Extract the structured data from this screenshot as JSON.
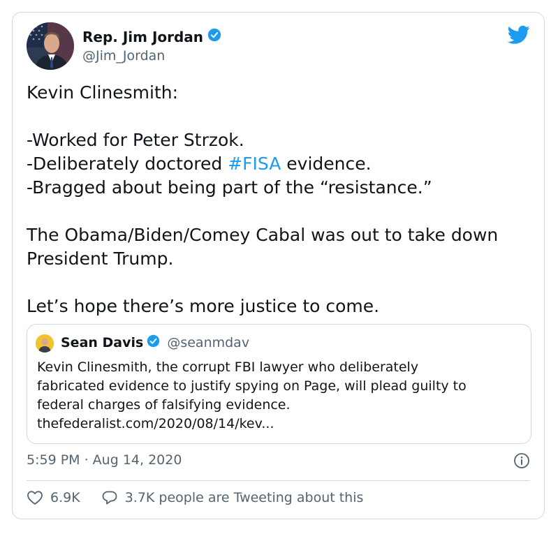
{
  "author": {
    "display_name": "Rep. Jim Jordan",
    "handle": "@Jim_Jordan",
    "verified": true
  },
  "tweet": {
    "lines": [
      "Kevin Clinesmith:",
      "",
      "-Worked for Peter Strzok.",
      "-Deliberately doctored ",
      "#FISA",
      " evidence.",
      "-Bragged about being part of the “resistance.”",
      "",
      "The Obama/Biden/Comey Cabal was out to take down",
      "President Trump.",
      "",
      "Let’s hope there’s more justice to come."
    ]
  },
  "quoted": {
    "display_name": "Sean Davis",
    "handle": "@seanmdav",
    "verified": true,
    "lines": [
      "Kevin Clinesmith, the corrupt FBI lawyer who deliberately",
      "fabricated evidence to justify spying on Page, will plead guilty to",
      "federal charges of falsifying evidence.",
      "thefederalist.com/2020/08/14/kev..."
    ]
  },
  "timestamp": "5:59 PM · Aug 14, 2020",
  "engagement": {
    "likes": "6.9K",
    "tweeting": "3.7K people are Tweeting about this"
  },
  "icons": [
    "verified-badge-icon",
    "twitter-bird-icon",
    "info-icon",
    "heart-icon",
    "reply-bubble-icon"
  ],
  "colors": {
    "link": "#1d9bf0",
    "secondary_text": "#536471",
    "border": "#cfd9de",
    "text": "#0f1419"
  }
}
